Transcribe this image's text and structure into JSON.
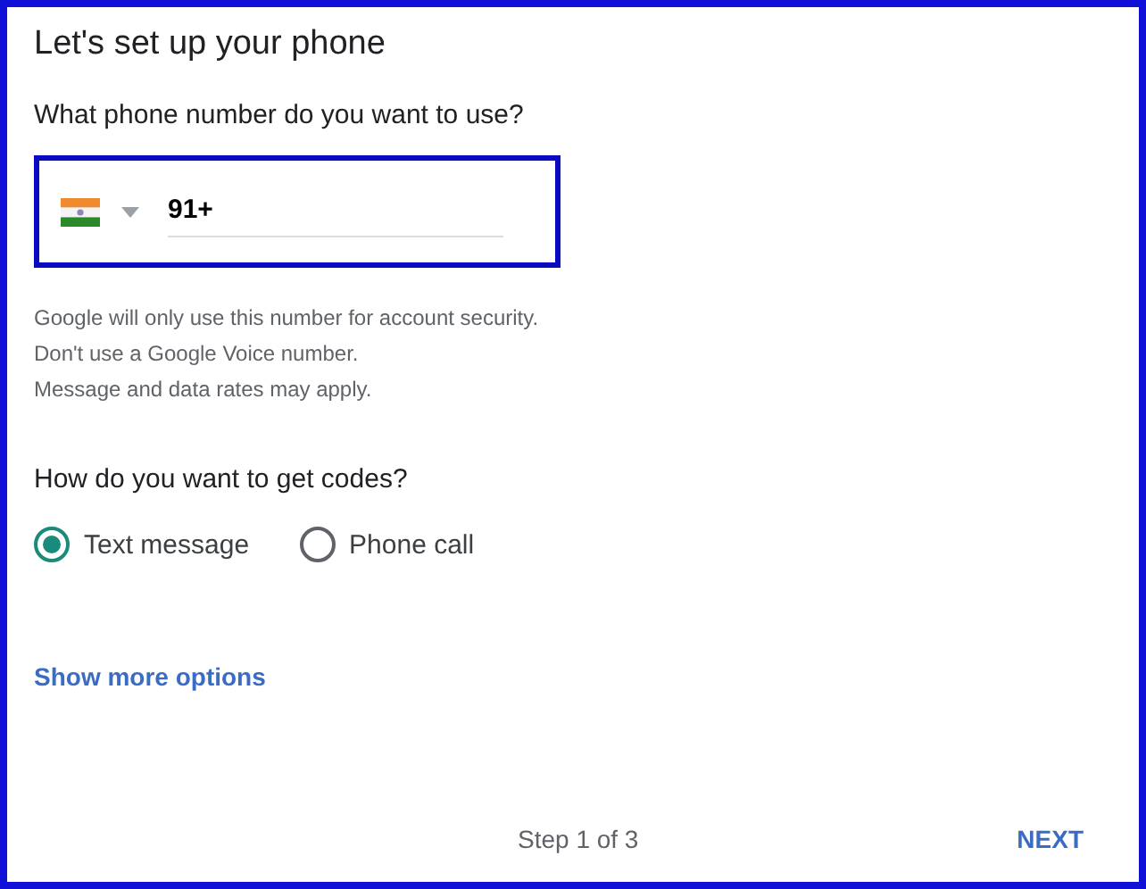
{
  "title": "Let's set up your phone",
  "phone": {
    "label": "What phone number do you want to use?",
    "value": "91+"
  },
  "hints": [
    "Google will only use this number for account security.",
    "Don't use a Google Voice number.",
    "Message and data rates may apply."
  ],
  "codes": {
    "question": "How do you want to get codes?",
    "options": [
      {
        "label": "Text message",
        "selected": true
      },
      {
        "label": "Phone call",
        "selected": false
      }
    ]
  },
  "more_link": "Show more options",
  "footer": {
    "step": "Step 1 of 3",
    "next": "NEXT"
  }
}
